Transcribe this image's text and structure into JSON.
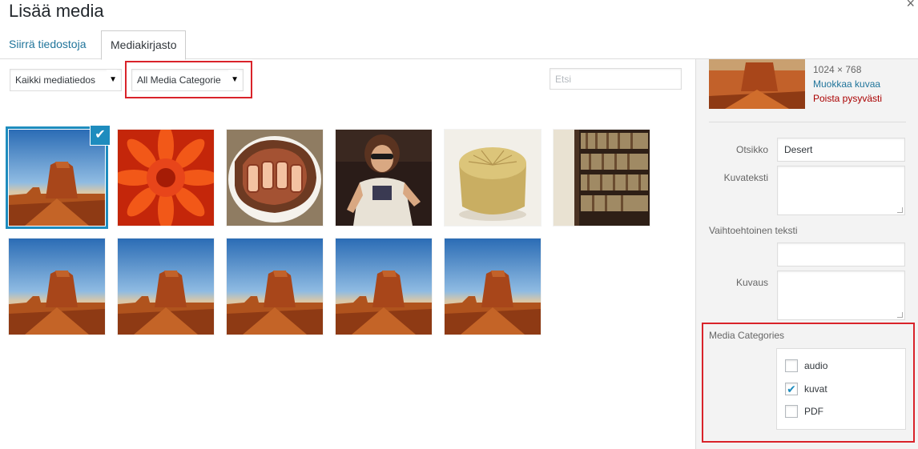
{
  "modal": {
    "title": "Lisää media",
    "close_glyph": "×"
  },
  "tabs": [
    {
      "label": "Siirrä tiedostoja",
      "active": false
    },
    {
      "label": "Mediakirjasto",
      "active": true
    }
  ],
  "toolbar": {
    "media_type_filter": {
      "selected": "Kaikki mediatiedos",
      "arrow": "▼"
    },
    "category_filter": {
      "selected": "All Media Categorie",
      "arrow": "▼"
    },
    "search": {
      "placeholder": "Etsi",
      "value": ""
    }
  },
  "attachments": [
    {
      "image": "desert-butte",
      "selected": true
    },
    {
      "image": "orange-flower",
      "selected": false
    },
    {
      "image": "spam-pizza",
      "selected": false
    },
    {
      "image": "woman-sunglasses",
      "selected": false
    },
    {
      "image": "wooden-object",
      "selected": false
    },
    {
      "image": "bookshelf",
      "selected": false
    },
    {
      "image": "desert-butte",
      "selected": false
    },
    {
      "image": "desert-butte",
      "selected": false
    },
    {
      "image": "desert-butte",
      "selected": false
    },
    {
      "image": "desert-butte",
      "selected": false
    },
    {
      "image": "desert-butte",
      "selected": false
    }
  ],
  "selection_check_glyph": "✔",
  "details": {
    "dimensions": "1024 × 768",
    "edit_link": "Muokkaa kuvaa",
    "delete_link": "Poista pysyvästi",
    "fields": {
      "title_label": "Otsikko",
      "title_value": "Desert",
      "caption_label": "Kuvateksti",
      "caption_value": "",
      "alt_label": "Vaihtoehtoinen teksti",
      "alt_value": "",
      "description_label": "Kuvaus",
      "description_value": ""
    },
    "media_categories": {
      "label": "Media Categories",
      "check_glyph": "✔",
      "items": [
        {
          "name": "audio",
          "checked": false
        },
        {
          "name": "kuvat",
          "checked": true
        },
        {
          "name": "PDF",
          "checked": false
        }
      ]
    }
  },
  "colors": {
    "accent": "#1e8cbe",
    "link": "#21759b",
    "delete": "#a00000",
    "highlight": "#d9232a"
  }
}
